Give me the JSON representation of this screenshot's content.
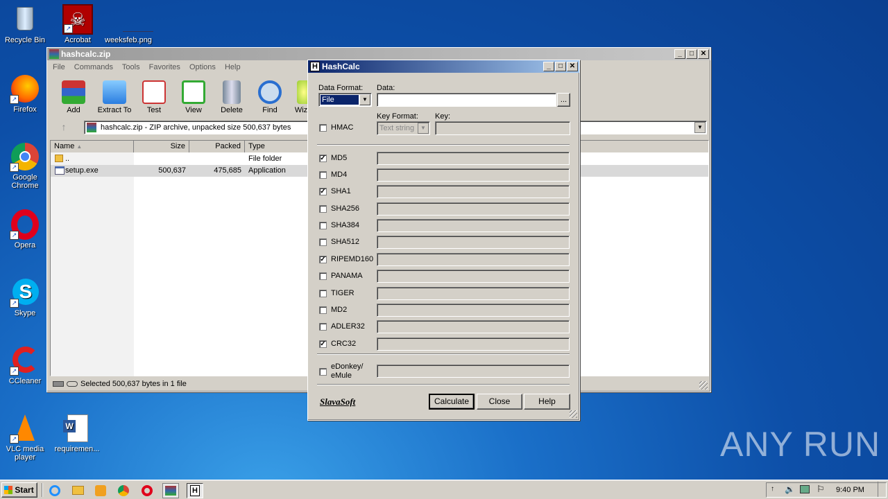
{
  "desktop": {
    "icons": [
      {
        "label": "Recycle Bin",
        "icon": "recycle-bin-icon"
      },
      {
        "label": "Acrobat",
        "icon": "acrobat-icon"
      },
      {
        "label": "weeksfeb.png",
        "icon": "image-file-icon"
      },
      {
        "label": "Firefox",
        "icon": "firefox-icon"
      },
      {
        "label": "Google Chrome",
        "icon": "chrome-icon"
      },
      {
        "label": "Opera",
        "icon": "opera-icon"
      },
      {
        "label": "Skype",
        "icon": "skype-icon"
      },
      {
        "label": "CCleaner",
        "icon": "ccleaner-icon"
      },
      {
        "label": "VLC media player",
        "icon": "vlc-icon"
      },
      {
        "label": "requiremen...",
        "icon": "word-doc-icon"
      }
    ],
    "watermark": "ANY RUN"
  },
  "winrar": {
    "title": "hashcalc.zip",
    "menu": [
      "File",
      "Commands",
      "Tools",
      "Favorites",
      "Options",
      "Help"
    ],
    "toolbar": [
      "Add",
      "Extract To",
      "Test",
      "View",
      "Delete",
      "Find",
      "Wiz"
    ],
    "path": "hashcalc.zip - ZIP archive, unpacked size 500,637 bytes",
    "columns": [
      "Name",
      "Size",
      "Packed",
      "Type"
    ],
    "rows": [
      {
        "name": "..",
        "size": "",
        "packed": "",
        "type": "File folder"
      },
      {
        "name": "setup.exe",
        "size": "500,637",
        "packed": "475,685",
        "type": "Application"
      }
    ],
    "status": "Selected 500,637 bytes in 1 file"
  },
  "hashcalc": {
    "title": "HashCalc",
    "data_format_label": "Data Format:",
    "data_format_value": "File",
    "data_label": "Data:",
    "data_value": "",
    "browse_label": "...",
    "hmac_label": "HMAC",
    "key_format_label": "Key Format:",
    "key_format_value": "Text string",
    "key_label": "Key:",
    "algorithms": [
      {
        "name": "MD5",
        "checked": true
      },
      {
        "name": "MD4",
        "checked": false
      },
      {
        "name": "SHA1",
        "checked": true
      },
      {
        "name": "SHA256",
        "checked": false
      },
      {
        "name": "SHA384",
        "checked": false
      },
      {
        "name": "SHA512",
        "checked": false
      },
      {
        "name": "RIPEMD160",
        "checked": true
      },
      {
        "name": "PANAMA",
        "checked": false
      },
      {
        "name": "TIGER",
        "checked": false
      },
      {
        "name": "MD2",
        "checked": false
      },
      {
        "name": "ADLER32",
        "checked": false
      },
      {
        "name": "CRC32",
        "checked": true
      }
    ],
    "edonkey_line1": "eDonkey/",
    "edonkey_line2": "eMule",
    "brand": "SlavaSoft",
    "calculate_label": "Calculate",
    "close_label": "Close",
    "help_label": "Help"
  },
  "taskbar": {
    "start_label": "Start",
    "clock": "9:40 PM"
  }
}
